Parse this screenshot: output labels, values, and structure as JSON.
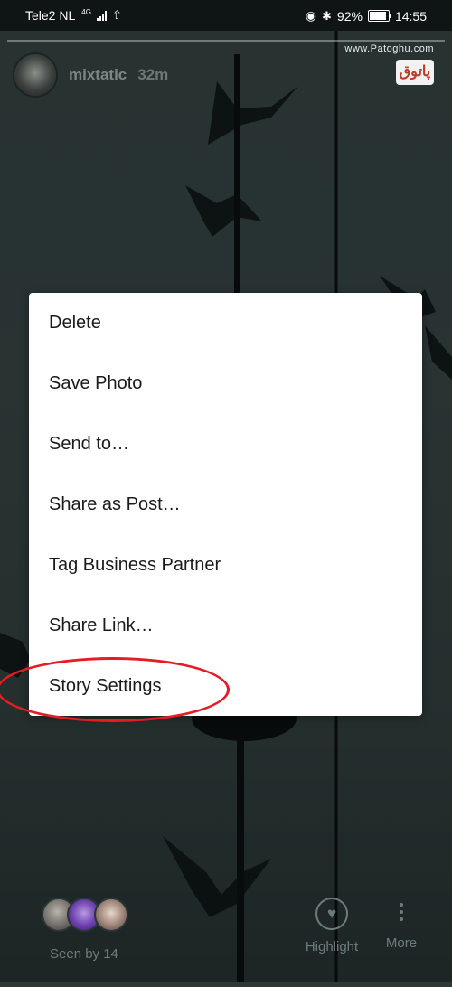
{
  "status_bar": {
    "carrier": "Tele2 NL",
    "network": "4G",
    "battery": "92%",
    "time": "14:55"
  },
  "story": {
    "username": "mixtatic",
    "time_ago": "32m",
    "watermark": "www.Patoghu.com",
    "watermark_logo": "پاتوق"
  },
  "menu": {
    "items": [
      {
        "label": "Delete"
      },
      {
        "label": "Save Photo"
      },
      {
        "label": "Send to…"
      },
      {
        "label": "Share as Post…"
      },
      {
        "label": "Tag Business Partner"
      },
      {
        "label": "Share Link…"
      },
      {
        "label": "Story Settings"
      }
    ]
  },
  "footer": {
    "seen_by": "Seen by 14",
    "highlight_label": "Highlight",
    "more_label": "More"
  },
  "colors": {
    "annotation_ellipse": "#e41c23",
    "menu_background": "#ffffff"
  }
}
